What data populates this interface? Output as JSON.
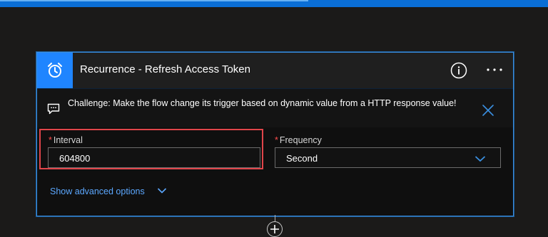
{
  "card": {
    "title": "Recurrence - Refresh Access Token",
    "trigger_icon": "alarm-clock-icon",
    "info_icon": "info-icon",
    "more_icon": "ellipsis-icon"
  },
  "challenge": {
    "icon": "comment-icon",
    "text": "Challenge: Make the flow change its trigger based on dynamic value from a HTTP response value!",
    "close_icon": "close-icon"
  },
  "fields": {
    "required_marker": "*",
    "interval": {
      "label": "Interval",
      "value": "604800"
    },
    "frequency": {
      "label": "Frequency",
      "value": "Second",
      "icon": "chevron-down-icon"
    }
  },
  "advanced": {
    "label": "Show advanced options",
    "icon": "chevron-down-icon"
  },
  "add_step": {
    "icon": "plus-icon"
  },
  "colors": {
    "accent": "#1f85ff",
    "link": "#5ca8ff",
    "highlight": "#e0454a",
    "required": "#ff4d4d"
  }
}
